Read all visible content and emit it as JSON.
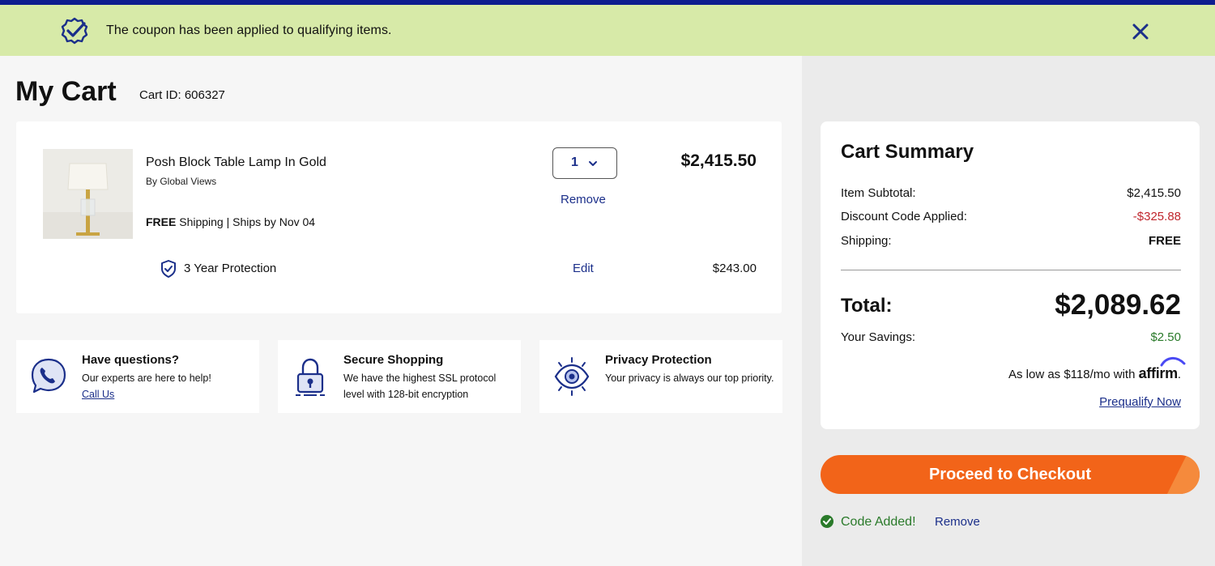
{
  "banner": {
    "message": "The coupon has been applied to qualifying items.",
    "colors": {
      "background": "#d7eaa8",
      "top_bar": "#0d1d8f"
    }
  },
  "cart": {
    "title": "My Cart",
    "cart_id": "Cart ID: 606327"
  },
  "item": {
    "name": "Posh Block Table Lamp In Gold",
    "brand": "By Global Views",
    "shipping_bold": "FREE",
    "shipping_rest": " Shipping | Ships by Nov 04",
    "quantity": "1",
    "remove_label": "Remove",
    "price": "$2,415.50",
    "protection_label": "3 Year Protection",
    "protection_edit": "Edit",
    "protection_price": "$243.00"
  },
  "info_cards": [
    {
      "heading": "Have questions?",
      "text": "Our experts are here to help!",
      "link": "Call Us",
      "icon": "phone-chat-icon"
    },
    {
      "heading": "Secure Shopping",
      "text": "We have the highest SSL protocol level with 128-bit encryption",
      "icon": "padlock-icon"
    },
    {
      "heading": "Privacy Protection",
      "text": "Your privacy is always our top priority.",
      "icon": "eye-icon"
    }
  ],
  "summary": {
    "title": "Cart Summary",
    "rows": [
      {
        "label": "Item Subtotal:",
        "value": "$2,415.50"
      },
      {
        "label": "Discount Code Applied:",
        "value": "-$325.88"
      },
      {
        "label": "Shipping:",
        "value": "FREE"
      }
    ],
    "total_label": "Total:",
    "total_value": "$2,089.62",
    "savings_label": "Your Savings:",
    "savings_value": "$2.50",
    "affirm_text": "As low as $118/mo with",
    "affirm_logo": "affirm",
    "prequalify": "Prequalify Now"
  },
  "checkout": {
    "label": "Proceed to Checkout",
    "color": "#f26419"
  },
  "code_status": {
    "text": "Code Added!",
    "remove": "Remove"
  },
  "colors": {
    "link": "#1b2f8a",
    "discount": "#c0262d",
    "savings": "#2a7a2a"
  }
}
